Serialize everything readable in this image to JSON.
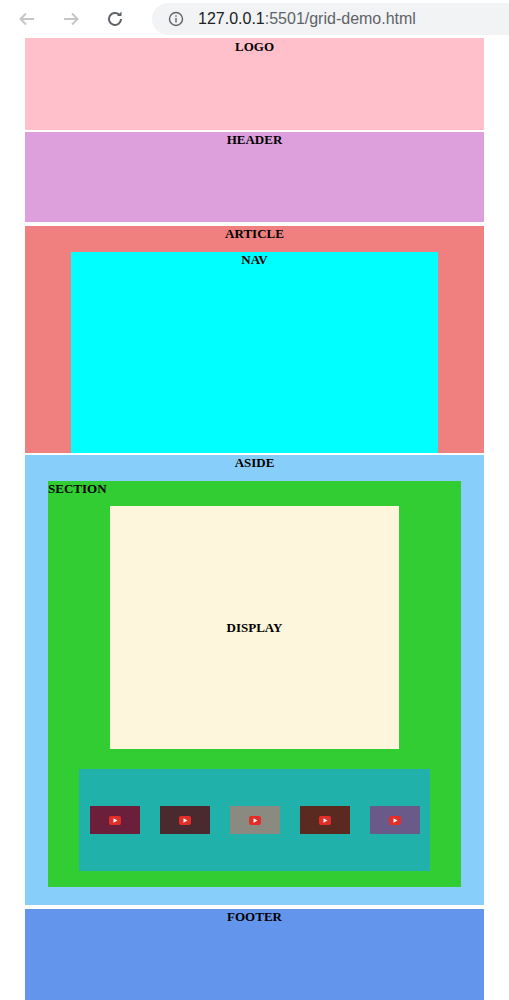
{
  "browser": {
    "back": {
      "disabled": true
    },
    "forward": {
      "disabled": true
    },
    "reload": {
      "disabled": false
    },
    "url_host": "127.0.0.1",
    "url_path": ":5501/grid-demo.html"
  },
  "logo": {
    "label": "LOGO"
  },
  "header": {
    "label": "HEADER"
  },
  "article": {
    "label": "ARTICLE",
    "nav": {
      "label": "NAV"
    }
  },
  "aside": {
    "label": "ASIDE",
    "section": {
      "label": "SECTION",
      "display": {
        "label": "DISPLAY"
      },
      "thumbnails": [
        {
          "kind": "video"
        },
        {
          "kind": "video"
        },
        {
          "kind": "video"
        },
        {
          "kind": "video"
        },
        {
          "kind": "video"
        }
      ]
    }
  },
  "footer": {
    "label": "FOOTER"
  }
}
